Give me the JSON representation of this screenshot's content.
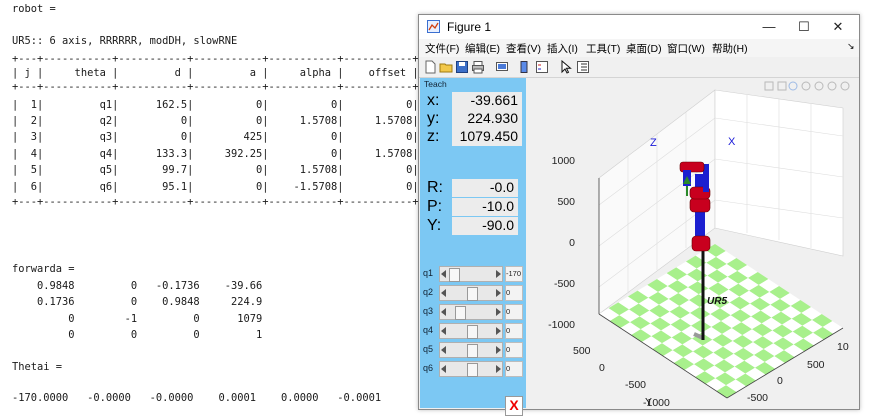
{
  "console": {
    "lines": [
      {
        "text": "robot =",
        "y": 3
      },
      {
        "text": "UR5:: 6 axis, RRRRRR, modDH, slowRNE",
        "y": 35
      },
      {
        "text": "+---+-----------+-----------+-----------+-----------+-----------+",
        "y": 53
      },
      {
        "text": "| j |     theta |         d |         a |     alpha |    offset |",
        "y": 67
      },
      {
        "text": "+---+-----------+-----------+-----------+-----------+-----------+",
        "y": 81
      },
      {
        "text": "|  1|         q1|      162.5|          0|          0|          0|",
        "y": 99
      },
      {
        "text": "|  2|         q2|          0|          0|     1.5708|     1.5708|",
        "y": 115
      },
      {
        "text": "|  3|         q3|          0|        425|          0|          0|",
        "y": 131
      },
      {
        "text": "|  4|         q4|      133.3|     392.25|          0|     1.5708|",
        "y": 148
      },
      {
        "text": "|  5|         q5|       99.7|          0|     1.5708|          0|",
        "y": 164
      },
      {
        "text": "|  6|         q6|       95.1|          0|    -1.5708|          0|",
        "y": 181
      },
      {
        "text": "+---+-----------+-----------+-----------+-----------+-----------+",
        "y": 196
      },
      {
        "text": "forwarda =",
        "y": 263
      },
      {
        "text": "    0.9848         0   -0.1736    -39.66",
        "y": 280
      },
      {
        "text": "    0.1736         0    0.9848     224.9",
        "y": 296
      },
      {
        "text": "         0        -1         0      1079",
        "y": 313
      },
      {
        "text": "         0         0         0         1",
        "y": 329
      },
      {
        "text": "Thetai =",
        "y": 361
      },
      {
        "text": "-170.0000   -0.0000   -0.0000    0.0001    0.0000   -0.0001",
        "y": 392
      }
    ]
  },
  "window": {
    "title": "Figure 1",
    "minimize": "—",
    "maximize": "☐",
    "close": "✕"
  },
  "menu": [
    "文件(F)",
    "编辑(E)",
    "查看(V)",
    "插入(I)",
    "工具(T)",
    "桌面(D)",
    "窗口(W)",
    "帮助(H)"
  ],
  "menu_extra": "↘",
  "teach": {
    "label": "Teach",
    "x_label": "x:",
    "x_value": "-39.661",
    "y_label": "y:",
    "y_value": "224.930",
    "z_label": "z:",
    "z_value": "1079.450",
    "r_label": "R:",
    "r_value": "-0.0",
    "p_label": "P:",
    "p_value": "-10.0",
    "yaw_label": "Y:",
    "yaw_value": "-90.0",
    "joints": [
      {
        "label": "q1",
        "value": "-170",
        "fraction": 0.03
      },
      {
        "label": "q2",
        "value": "0",
        "fraction": 0.5
      },
      {
        "label": "q3",
        "value": "0",
        "fraction": 0.18
      },
      {
        "label": "q4",
        "value": "0",
        "fraction": 0.5
      },
      {
        "label": "q5",
        "value": "0",
        "fraction": 0.5
      },
      {
        "label": "q6",
        "value": "0",
        "fraction": 0.5
      }
    ],
    "quit_label": "X"
  },
  "plot": {
    "z_ticks": [
      "1000",
      "500",
      "0",
      "-500",
      "-1000"
    ],
    "x_ticks": [
      "-1000",
      "-500",
      "0",
      "500",
      "10"
    ],
    "y_ticks": [
      "1000",
      "500",
      "0",
      "-500",
      "-1000"
    ],
    "x_label": "X",
    "y_label": "Y",
    "view_z_label": "Z",
    "view_x_label": "X",
    "robot_name": "UR5",
    "colors": {
      "check_green": "#a8f08c",
      "check_white": "#ffffff",
      "link_blue": "#1b1fd0",
      "joint_red": "#c8001e"
    }
  }
}
